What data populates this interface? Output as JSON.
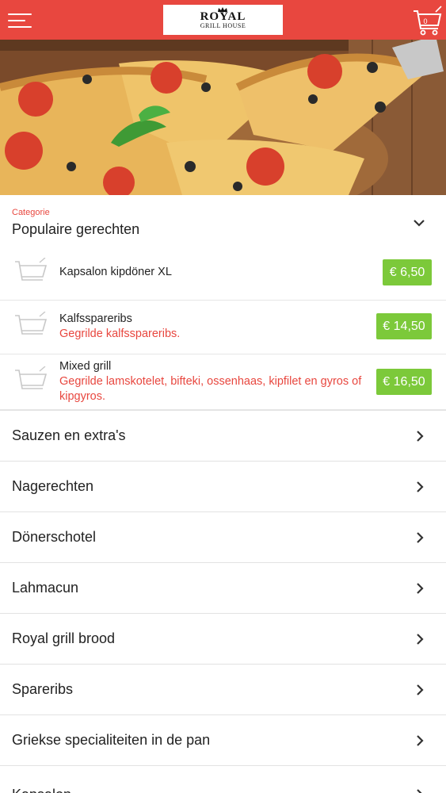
{
  "header": {
    "logo_main": "ROYAL",
    "logo_sub": "GRILL HOUSE",
    "cart_count": "0"
  },
  "category": {
    "label": "Categorie",
    "title": "Populaire gerechten"
  },
  "dishes": [
    {
      "name": "Kapsalon kipdöner XL",
      "desc": "",
      "price": "€ 6,50"
    },
    {
      "name": "Kalfsspareribs",
      "desc": "Gegrilde kalfsspareribs.",
      "price": "€ 14,50"
    },
    {
      "name": "Mixed grill",
      "desc": "Gegrilde lamskotelet, bifteki, ossenhaas, kipfilet en gyros of kipgyros.",
      "price": "€ 16,50"
    }
  ],
  "menu_categories": [
    "Sauzen en extra's",
    "Nagerechten",
    "Dönerschotel",
    "Lahmacun",
    "Royal grill brood",
    "Spareribs",
    "Griekse specialiteiten in de pan",
    "Kapsalon"
  ],
  "colors": {
    "header_bg": "#e8473f",
    "accent_text": "#e8473f",
    "price_bg": "#7cc93a"
  },
  "icons": {
    "menu": "hamburger-icon",
    "cart": "shopping-cart-icon",
    "expand": "chevron-down-icon",
    "row": "chevron-right-icon"
  }
}
